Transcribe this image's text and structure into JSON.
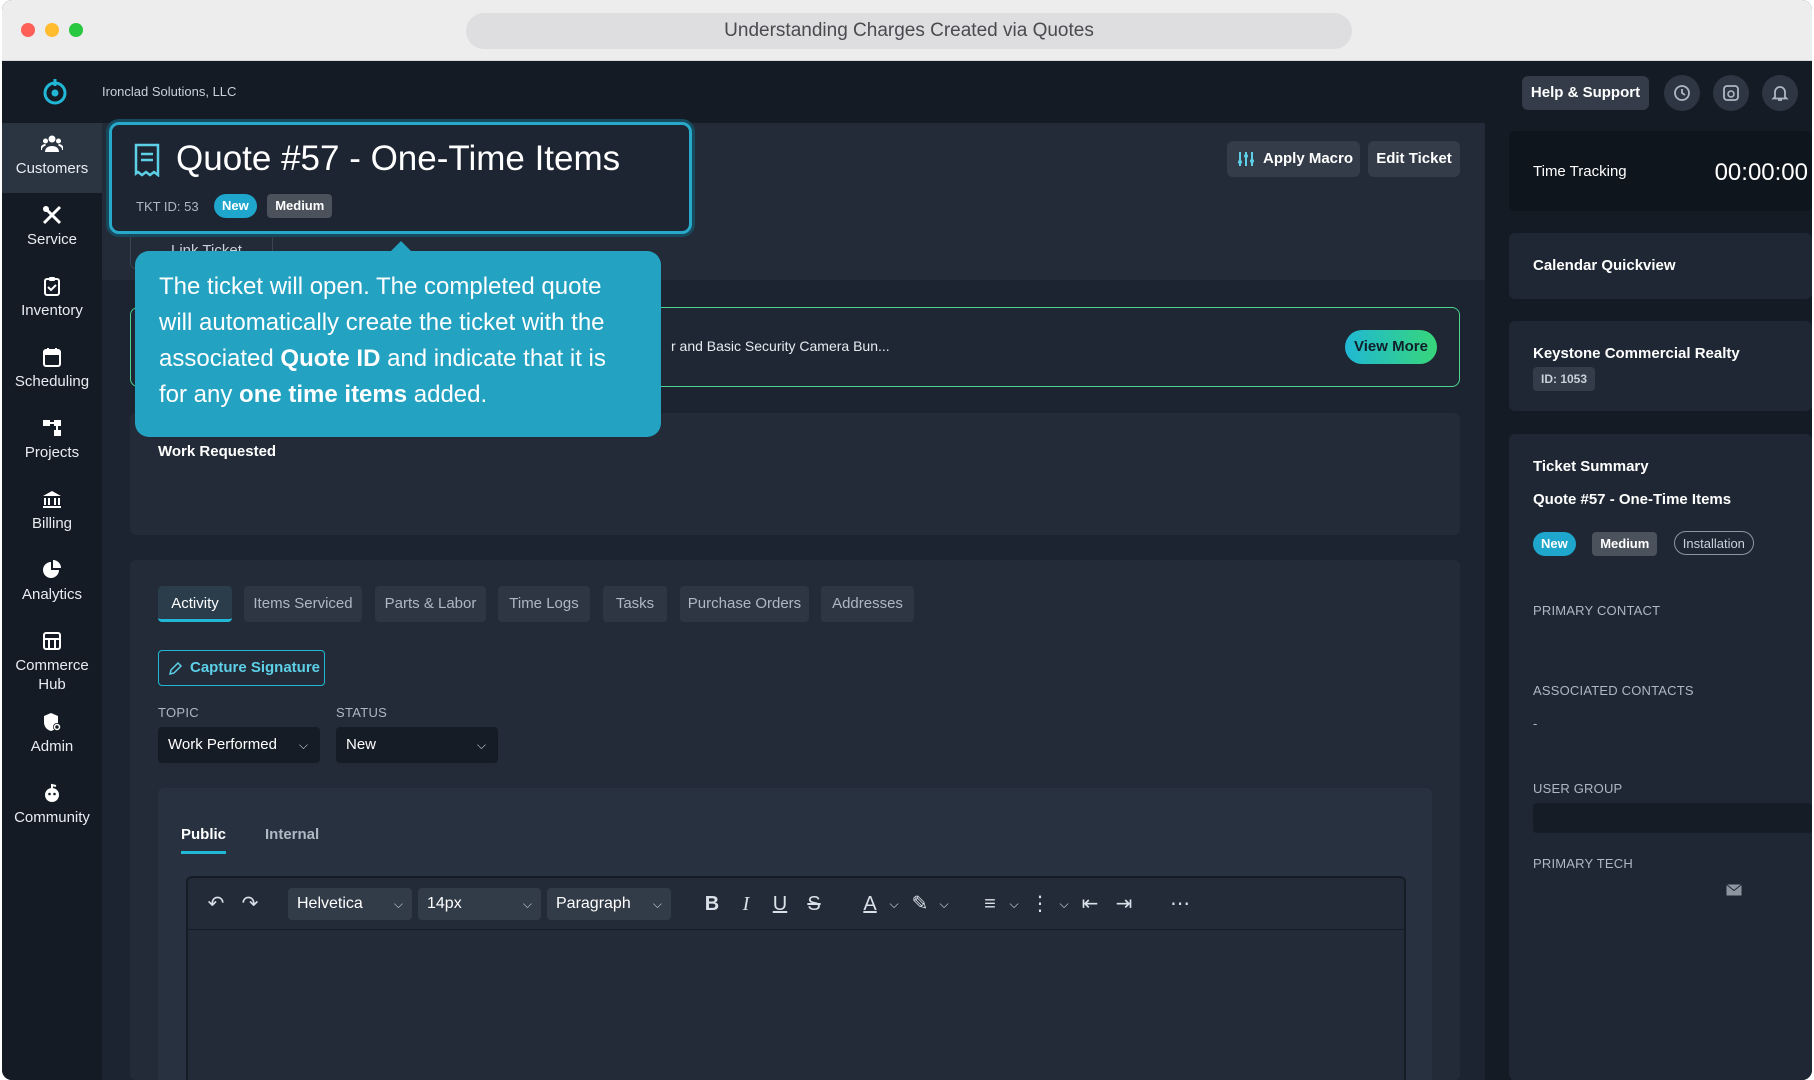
{
  "browser": {
    "title": "Understanding Charges Created via Quotes"
  },
  "header": {
    "company": "Ironclad Solutions, LLC",
    "help_label": "Help & Support"
  },
  "sidebar": {
    "items": [
      {
        "label": "Customers",
        "icon": "customers-icon"
      },
      {
        "label": "Service",
        "icon": "service-icon"
      },
      {
        "label": "Inventory",
        "icon": "inventory-icon"
      },
      {
        "label": "Scheduling",
        "icon": "calendar-icon"
      },
      {
        "label": "Projects",
        "icon": "projects-icon"
      },
      {
        "label": "Billing",
        "icon": "billing-icon"
      },
      {
        "label": "Analytics",
        "icon": "pie-chart-icon"
      },
      {
        "label": "Commerce Hub",
        "icon": "store-icon"
      },
      {
        "label": "Admin",
        "icon": "admin-icon"
      },
      {
        "label": "Community",
        "icon": "community-icon"
      }
    ]
  },
  "ticket": {
    "title": "Quote #57 - One-Time Items",
    "id_label": "TKT ID: 53",
    "status_badge": "New",
    "priority_badge": "Medium",
    "link_ticket": "Link Ticket",
    "apply_macro": "Apply Macro",
    "edit_ticket": "Edit Ticket",
    "banner_text": "r and Basic Security Camera Bun...",
    "view_more": "View More",
    "work_requested": "Work Requested"
  },
  "tooltip": {
    "part1": "The ticket will open. The completed quote will automatically create the ticket with the associated ",
    "bold1": "Quote ID",
    "part2": " and indicate that it is for any ",
    "bold2": "one time items",
    "part3": " added."
  },
  "activity": {
    "tabs": [
      "Activity",
      "Items Serviced",
      "Parts & Labor",
      "Time Logs",
      "Tasks",
      "Purchase Orders",
      "Addresses"
    ],
    "capture_signature": "Capture Signature",
    "topic_label": "TOPIC",
    "topic_value": "Work Performed",
    "status_label": "STATUS",
    "status_value": "New",
    "editor_tabs": [
      "Public",
      "Internal"
    ],
    "font_family": "Helvetica",
    "font_size": "14px",
    "block_type": "Paragraph"
  },
  "right_panel": {
    "time_tracking_label": "Time Tracking",
    "timer": "00:00:00",
    "calendar_label": "Calendar Quickview",
    "customer_name": "Keystone Commercial Realty",
    "customer_id": "ID: 1053",
    "summary_title": "Ticket Summary",
    "summary_ticket": "Quote #57 - One-Time Items",
    "summary_badges": [
      "New",
      "Medium",
      "Installation"
    ],
    "primary_contact": "PRIMARY CONTACT",
    "associated_contacts": "ASSOCIATED CONTACTS",
    "associated_value": "-",
    "user_group": "USER GROUP",
    "primary_tech": "PRIMARY TECH"
  },
  "colors": {
    "accent": "#20b8d4",
    "success": "#37d67a",
    "background": "#1b2430",
    "sidebar": "#141b24"
  }
}
